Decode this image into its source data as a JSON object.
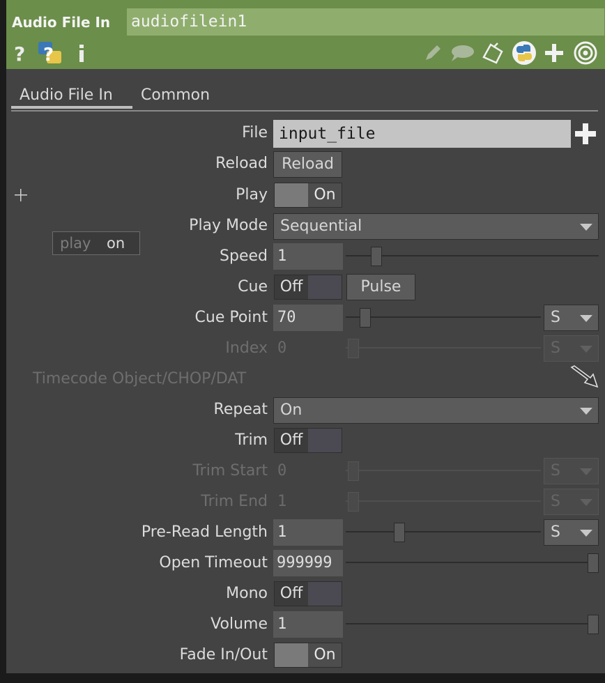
{
  "header": {
    "op_type": "Audio File In",
    "op_name": "audiofilein1",
    "icons": [
      "help-icon",
      "python-help-icon",
      "info-icon",
      "edit-icon",
      "comment-icon",
      "clone-icon",
      "python-icon",
      "add-icon",
      "viewer-icon"
    ]
  },
  "tabs": [
    {
      "label": "Audio File In",
      "active": true
    },
    {
      "label": "Common",
      "active": false
    }
  ],
  "params": {
    "file": {
      "label": "File",
      "value": "input_file"
    },
    "reload": {
      "label": "Reload",
      "button": "Reload"
    },
    "play": {
      "label": "Play",
      "state": "On"
    },
    "play_mode": {
      "label": "Play Mode",
      "value": "Sequential"
    },
    "speed": {
      "label": "Speed",
      "value": "1",
      "slider_fraction": 0.12
    },
    "cue": {
      "label": "Cue",
      "state": "Off",
      "pulse": "Pulse"
    },
    "cue_point": {
      "label": "Cue Point",
      "value": "70",
      "unit": "S",
      "slider_fraction": 0.1
    },
    "index": {
      "label": "Index",
      "value": "0",
      "unit": "S"
    },
    "timecode": {
      "label": "Timecode Object/CHOP/DAT"
    },
    "repeat": {
      "label": "Repeat",
      "value": "On"
    },
    "trim": {
      "label": "Trim",
      "state": "Off"
    },
    "trim_start": {
      "label": "Trim Start",
      "value": "0",
      "unit": "S"
    },
    "trim_end": {
      "label": "Trim End",
      "value": "1",
      "unit": "S"
    },
    "preread": {
      "label": "Pre-Read Length",
      "value": "1",
      "unit": "S",
      "slider_fraction": 0.27
    },
    "open_timeout": {
      "label": "Open Timeout",
      "value": "999999",
      "slider_fraction": 1.0
    },
    "mono": {
      "label": "Mono",
      "state": "Off"
    },
    "volume": {
      "label": "Volume",
      "value": "1",
      "slider_fraction": 1.0
    },
    "fade": {
      "label": "Fade In/Out",
      "state": "On"
    }
  },
  "side": {
    "play_badge_name": "play",
    "play_badge_state": "on"
  },
  "colors": {
    "header": "#6b8e4a",
    "panel": "#434343",
    "field": "#585858"
  }
}
